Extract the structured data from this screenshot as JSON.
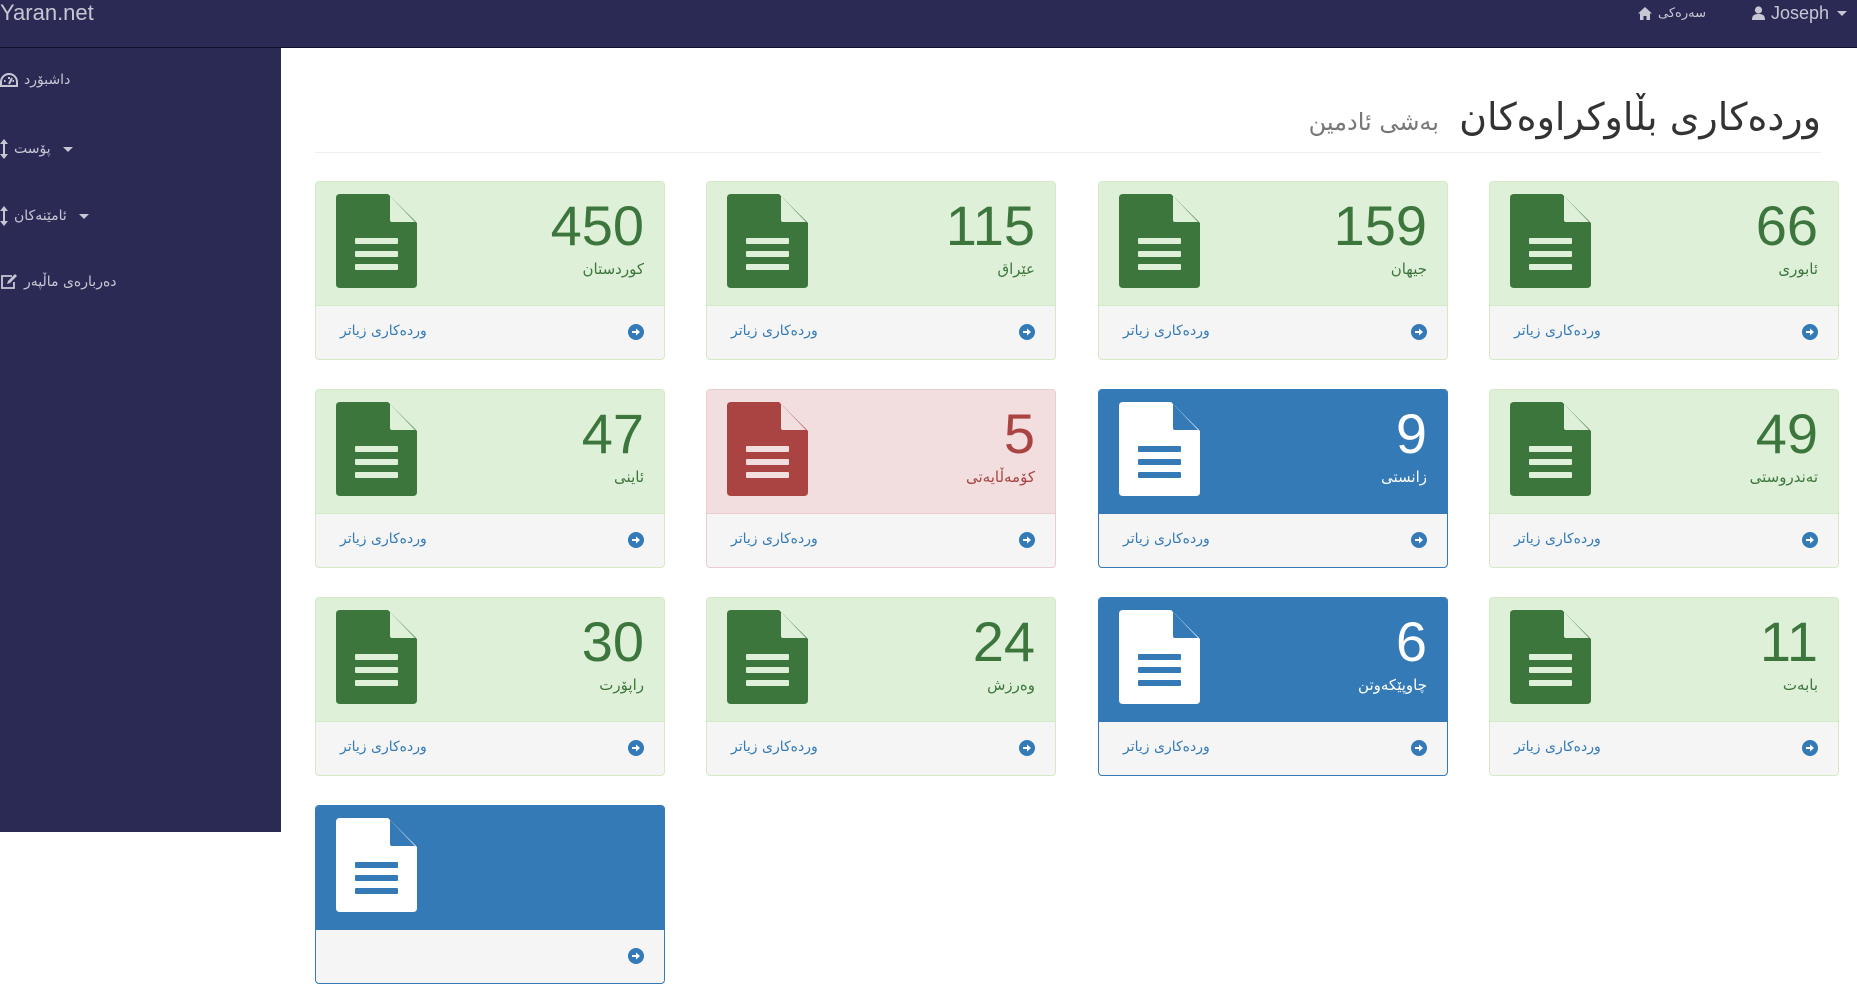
{
  "topbar": {
    "brand": "Yaran.net",
    "home_label": "سەرەکی",
    "user_name": "Joseph"
  },
  "sidebar": {
    "items": [
      {
        "label": "داشبۆرد",
        "icon": "dashboard-icon"
      },
      {
        "label": "پۆست",
        "icon": "sort-arrows-icon"
      },
      {
        "label": "ئامێنەکان",
        "icon": "sort-arrows-icon"
      },
      {
        "label": "دەربارەی ماڵپەر",
        "icon": "edit-icon"
      }
    ]
  },
  "page": {
    "title": "وردەکاری بڵاوکراوەکان",
    "subtitle": "بەشی ئادمین"
  },
  "panel_colors": {
    "green": "#3c763d",
    "red": "#a94442",
    "blue": "#337ab7"
  },
  "panels": [
    {
      "count": "450",
      "category": "کوردستان",
      "more": "وردەکاری زیاتر",
      "style": "green"
    },
    {
      "count": "115",
      "category": "عێراق",
      "more": "وردەکاری زیاتر",
      "style": "green"
    },
    {
      "count": "159",
      "category": "جیهان",
      "more": "وردەکاری زیاتر",
      "style": "green"
    },
    {
      "count": "66",
      "category": "ئابوری",
      "more": "وردەکاری زیاتر",
      "style": "green"
    },
    {
      "count": "47",
      "category": "ئاینی",
      "more": "وردەکاری زیاتر",
      "style": "green"
    },
    {
      "count": "5",
      "category": "کۆمەڵایەتی",
      "more": "وردەکاری زیاتر",
      "style": "red"
    },
    {
      "count": "9",
      "category": "زانستی",
      "more": "وردەکاری زیاتر",
      "style": "blue"
    },
    {
      "count": "49",
      "category": "تەندروستی",
      "more": "وردەکاری زیاتر",
      "style": "green"
    },
    {
      "count": "30",
      "category": "راپۆرت",
      "more": "وردەکاری زیاتر",
      "style": "green"
    },
    {
      "count": "24",
      "category": "وەرزش",
      "more": "وردەکاری زیاتر",
      "style": "green"
    },
    {
      "count": "6",
      "category": "چاوپێکەوتن",
      "more": "وردەکاری زیاتر",
      "style": "blue"
    },
    {
      "count": "11",
      "category": "بابەت",
      "more": "وردەکاری زیاتر",
      "style": "green"
    },
    {
      "count": "",
      "category": "",
      "more": "",
      "style": "blue"
    }
  ]
}
